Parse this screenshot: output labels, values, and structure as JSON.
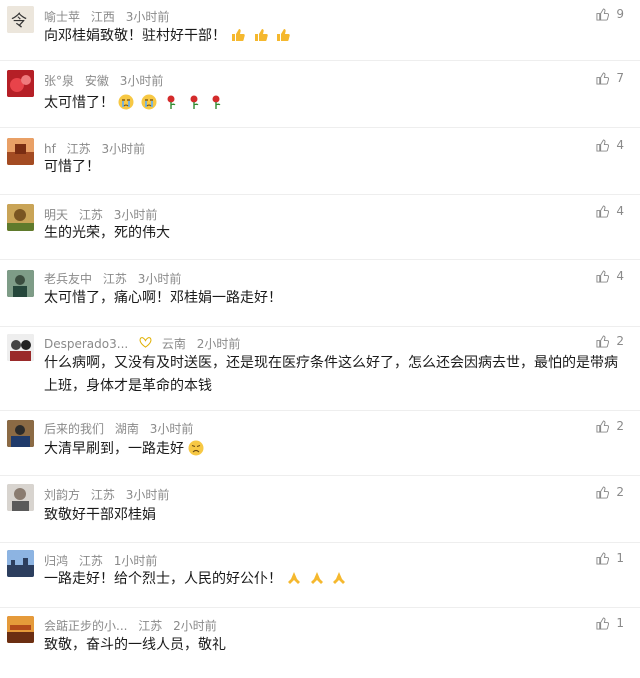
{
  "comments": [
    {
      "name": "喻士苹",
      "region": "江西",
      "time": "3小时前",
      "likes": "9",
      "text": "向邓桂娟致敬！驻村好干部！",
      "emoji": [
        "thumbs-up",
        "thumbs-up",
        "thumbs-up"
      ]
    },
    {
      "name": "张°泉",
      "region": "安徽",
      "time": "3小时前",
      "likes": "7",
      "text": "太可惜了！",
      "emoji": [
        "crying-face",
        "crying-face",
        "rose",
        "rose",
        "rose"
      ]
    },
    {
      "name": "hf",
      "region": "江苏",
      "time": "3小时前",
      "likes": "4",
      "text": "可惜了！",
      "emoji": []
    },
    {
      "name": "明天",
      "region": "江苏",
      "time": "3小时前",
      "likes": "4",
      "text": "生的光荣，死的伟大",
      "emoji": []
    },
    {
      "name": "老兵友中",
      "region": "江苏",
      "time": "3小时前",
      "likes": "4",
      "text": "太可惜了，痛心啊！邓桂娟一路走好！",
      "emoji": []
    },
    {
      "name": "Desperado3...",
      "region": "云南",
      "time": "2小时前",
      "likes": "2",
      "text": "什么病啊，又没有及时送医，还是现在医疗条件这么好了，怎么还会因病去世，最怕的是带病上班，身体才是革命的本钱",
      "emoji": []
    },
    {
      "name": "后来的我们",
      "region": "湖南",
      "time": "3小时前",
      "likes": "2",
      "text": "大清早刷到，一路走好",
      "emoji": [
        "sad-face"
      ]
    },
    {
      "name": "刘韵方",
      "region": "江苏",
      "time": "3小时前",
      "likes": "2",
      "text": "致敬好干部邓桂娟",
      "emoji": []
    },
    {
      "name": "归鸿",
      "region": "江苏",
      "time": "1小时前",
      "likes": "1",
      "text": "一路走好！给个烈士，人民的好公仆！",
      "emoji": [
        "folded-hands",
        "folded-hands",
        "folded-hands"
      ]
    },
    {
      "name": "会踮正步的小...",
      "region": "江苏",
      "time": "2小时前",
      "likes": "1",
      "text": "致敬，奋斗的一线人员，敬礼",
      "emoji": []
    }
  ],
  "colors": {
    "meta": "#8a8a8a",
    "text": "#1a1a1a",
    "divider": "#eeeeee",
    "badge": "#e0b000"
  }
}
